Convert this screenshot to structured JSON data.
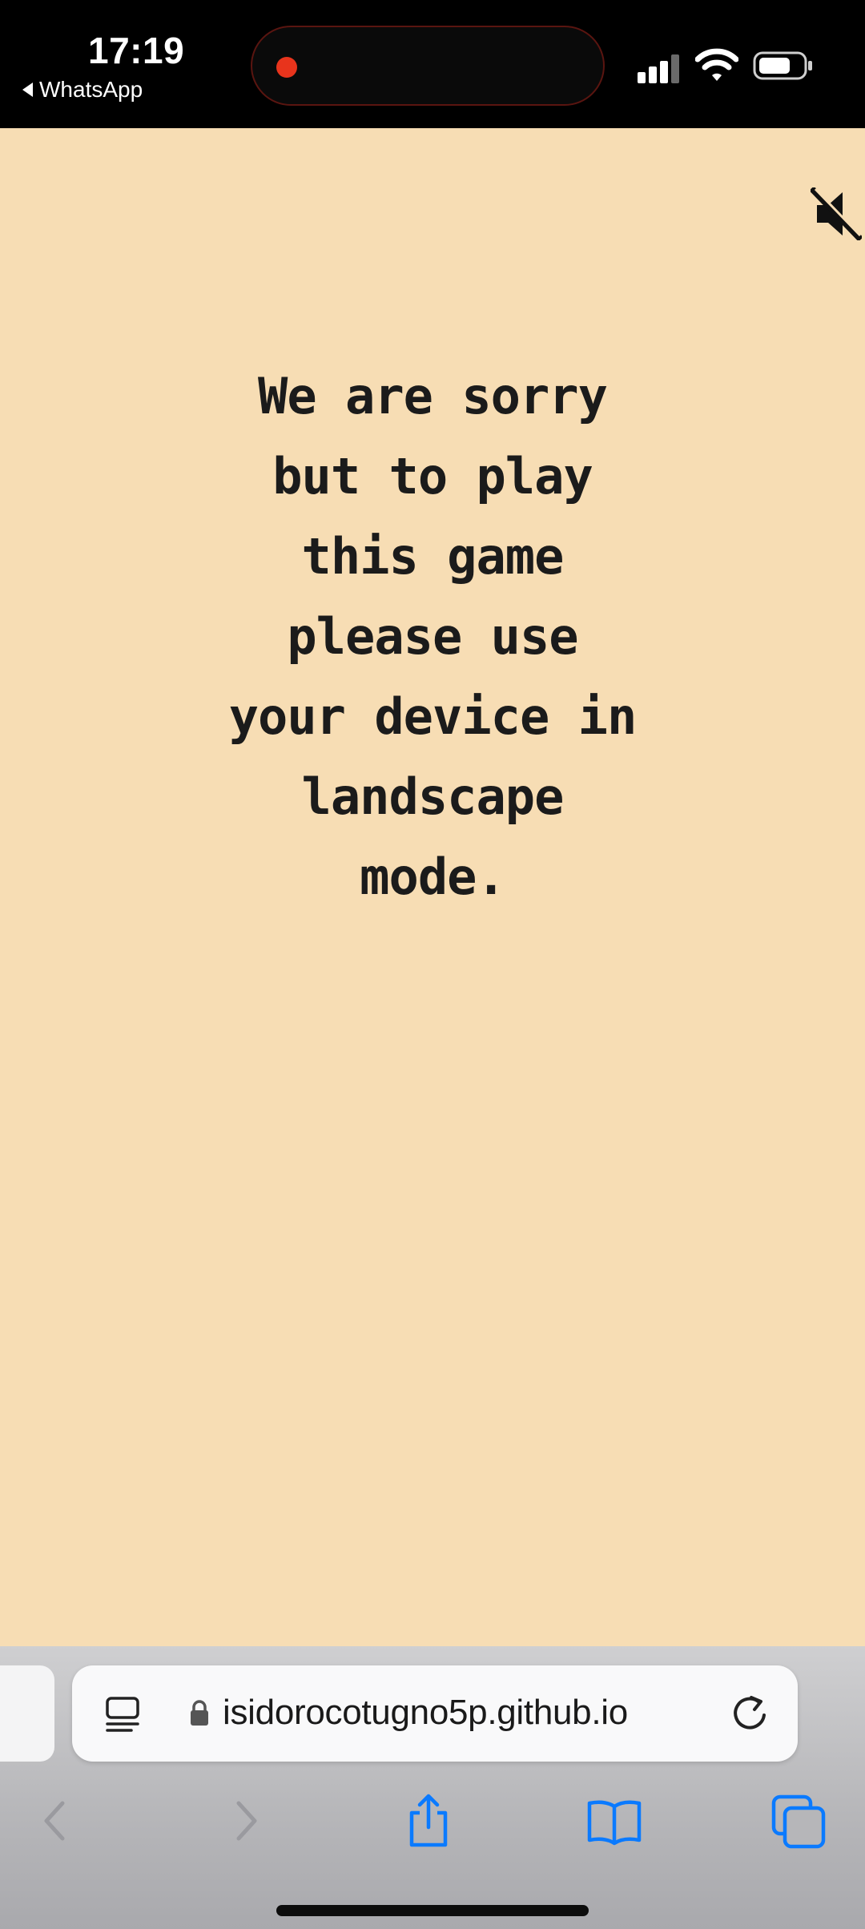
{
  "status_bar": {
    "time": "17:19",
    "back_app_label": "WhatsApp",
    "recording_color": "#e8341c",
    "icons": [
      "cellular-signal-icon",
      "wifi-icon",
      "battery-icon"
    ]
  },
  "game": {
    "background_color": "#f7ddb4",
    "sound_icon": "speaker-muted-icon",
    "message_lines": [
      "We are sorry",
      "but to play",
      "this game",
      "please use",
      "your device in",
      "landscape",
      "mode."
    ]
  },
  "browser": {
    "url": "isidorocotugno5p.github.io",
    "address_icons": [
      "reader-mode-icon",
      "lock-icon",
      "reload-icon"
    ],
    "toolbar": {
      "buttons": [
        "back-icon",
        "forward-icon",
        "share-icon",
        "bookmarks-icon",
        "tabs-icon"
      ],
      "back_enabled": false,
      "forward_enabled": false,
      "accent_color": "#0a7aff"
    }
  }
}
